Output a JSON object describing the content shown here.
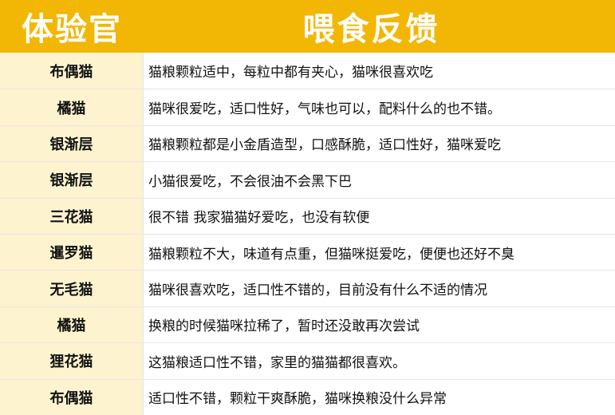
{
  "header": {
    "left": "体验官",
    "right": "喂食反馈"
  },
  "rows": [
    {
      "name": "布偶猫",
      "feedback": "猫粮颗粒适中，每粒中都有夹心，猫咪很喜欢吃"
    },
    {
      "name": "橘猫",
      "feedback": "猫咪很爱吃，适口性好，气味也可以，配料什么的也不错。"
    },
    {
      "name": "银渐层",
      "feedback": "猫粮颗粒都是小金盾造型，口感酥脆，适口性好，猫咪爱吃"
    },
    {
      "name": "银渐层",
      "feedback": "小猫很爱吃，不会很油不会黑下巴"
    },
    {
      "name": "三花猫",
      "feedback": "很不错 我家猫猫好爱吃，也没有软便"
    },
    {
      "name": "暹罗猫",
      "feedback": "猫粮颗粒不大，味道有点重，但猫咪挺爱吃，便便也还好不臭"
    },
    {
      "name": "无毛猫",
      "feedback": "猫咪很喜欢吃，适口性不错的，目前没有什么不适的情况"
    },
    {
      "name": "橘猫",
      "feedback": "换粮的时候猫咪拉稀了，暂时还没敢再次尝试"
    },
    {
      "name": "狸花猫",
      "feedback": "这猫粮适口性不错，家里的猫猫都很喜欢。"
    },
    {
      "name": "布偶猫",
      "feedback": "适口性不错，颗粒干爽酥脆，猫咪换粮没什么异常"
    }
  ],
  "colors": {
    "header_bg": "#f2b705",
    "name_col_bg": "#fdf3cf"
  }
}
